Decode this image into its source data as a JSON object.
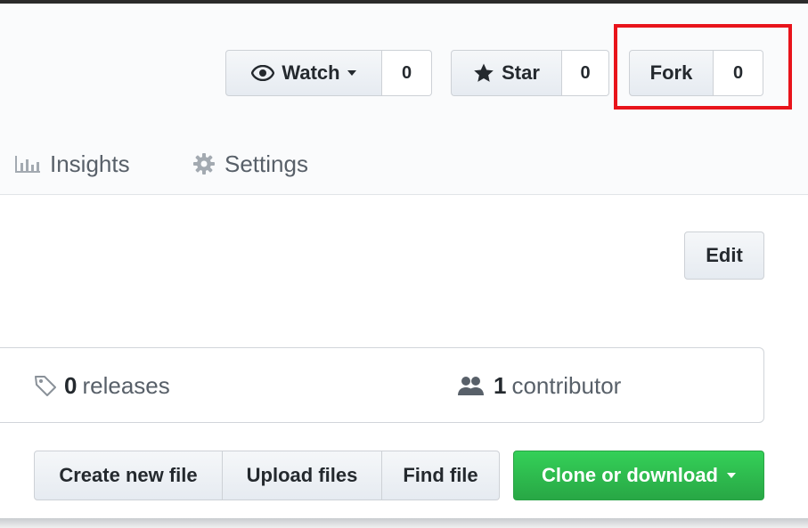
{
  "repo_actions": {
    "watch": {
      "label": "Watch",
      "count": "0"
    },
    "star": {
      "label": "Star",
      "count": "0"
    },
    "fork": {
      "label": "Fork",
      "count": "0"
    }
  },
  "nav": {
    "insights_label": "Insights",
    "settings_label": "Settings"
  },
  "edit_label": "Edit",
  "summary": {
    "releases_count": "0",
    "releases_label": "releases",
    "contributors_count": "1",
    "contributors_label": "contributor"
  },
  "file_actions": {
    "create_label": "Create new file",
    "upload_label": "Upload files",
    "find_label": "Find file",
    "clone_label": "Clone or download"
  },
  "colors": {
    "highlight": "#e8141b",
    "clone_green": "#28a745",
    "text": "#24292e",
    "muted": "#586069"
  }
}
